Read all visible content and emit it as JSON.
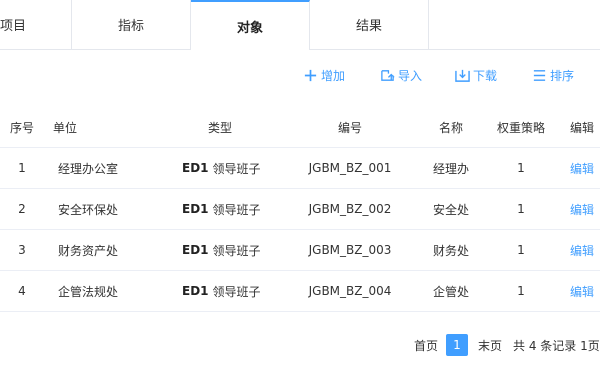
{
  "tabs": [
    {
      "label": "项目"
    },
    {
      "label": "指标"
    },
    {
      "label": "对象"
    },
    {
      "label": "结果"
    }
  ],
  "toolbar": {
    "add_label": "增加",
    "import_label": "导入",
    "download_label": "下载",
    "sort_label": "排序"
  },
  "table": {
    "headers": [
      "序号",
      "单位",
      "类型",
      "编号",
      "名称",
      "权重策略",
      "编辑"
    ],
    "rows": [
      {
        "index": "1",
        "unit": "经理办公室",
        "type_code": "ED1",
        "type_name": "领导班子",
        "code": "JGBM_BZ_001",
        "name": "经理办",
        "weight": "1",
        "edit": "编辑"
      },
      {
        "index": "2",
        "unit": "安全环保处",
        "type_code": "ED1",
        "type_name": "领导班子",
        "code": "JGBM_BZ_002",
        "name": "安全处",
        "weight": "1",
        "edit": "编辑"
      },
      {
        "index": "3",
        "unit": "财务资产处",
        "type_code": "ED1",
        "type_name": "领导班子",
        "code": "JGBM_BZ_003",
        "name": "财务处",
        "weight": "1",
        "edit": "编辑"
      },
      {
        "index": "4",
        "unit": "企管法规处",
        "type_code": "ED1",
        "type_name": "领导班子",
        "code": "JGBM_BZ_004",
        "name": "企管处",
        "weight": "1",
        "edit": "编辑"
      }
    ]
  },
  "pagination": {
    "first_label": "首页",
    "current_page": "1",
    "last_label": "末页",
    "summary": "共 4 条记录 1页"
  },
  "colors": {
    "accent": "#409eff",
    "border": "#e4e7ed"
  }
}
